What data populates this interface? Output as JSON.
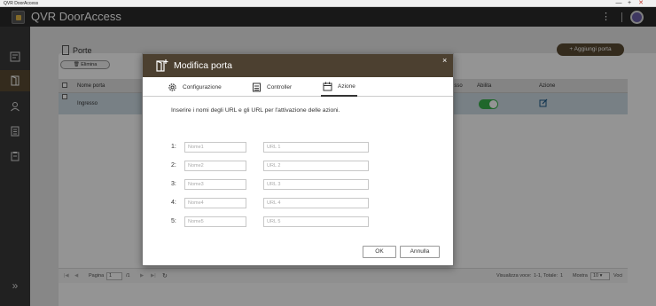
{
  "os": {
    "title": "QVR DoorAccess",
    "min": "—",
    "max": "+",
    "close": "✕"
  },
  "header": {
    "title": "QVR DoorAccess",
    "menu": "⋮"
  },
  "sidebar": {
    "expand": "»"
  },
  "page": {
    "title": "Porte",
    "delete_label": "Elimina",
    "add_label": "Aggiungi porta",
    "table": {
      "col_name": "Nome porta",
      "col_access": "esso",
      "col_enable": "Abilita",
      "col_action": "Azione",
      "rows": [
        {
          "name": "Ingresso",
          "enabled": true
        }
      ]
    },
    "footer": {
      "page_label": "Pagina",
      "page_value": "1",
      "page_total": "/1",
      "view_label": "Visualizza voce:",
      "view_range": "1-1, Totale:",
      "view_total": "1",
      "show_label": "Mostra",
      "show_value": "10",
      "items_label": "Voci"
    }
  },
  "modal": {
    "title": "Modifica porta",
    "close": "×",
    "tabs": [
      {
        "label": "Configurazione"
      },
      {
        "label": "Controller"
      },
      {
        "label": "Azione"
      }
    ],
    "description": "Inserire i nomi degli URL e gli URL per l'attivazione delle azioni.",
    "rows": [
      {
        "label": "1:",
        "name_placeholder": "Nome1",
        "url_placeholder": "URL 1"
      },
      {
        "label": "2:",
        "name_placeholder": "Nome2",
        "url_placeholder": "URL 2"
      },
      {
        "label": "3:",
        "name_placeholder": "Nome3",
        "url_placeholder": "URL 3"
      },
      {
        "label": "4:",
        "name_placeholder": "Nome4",
        "url_placeholder": "URL 4"
      },
      {
        "label": "5:",
        "name_placeholder": "Nome5",
        "url_placeholder": "URL 5"
      }
    ],
    "ok_label": "OK",
    "cancel_label": "Annulla"
  }
}
